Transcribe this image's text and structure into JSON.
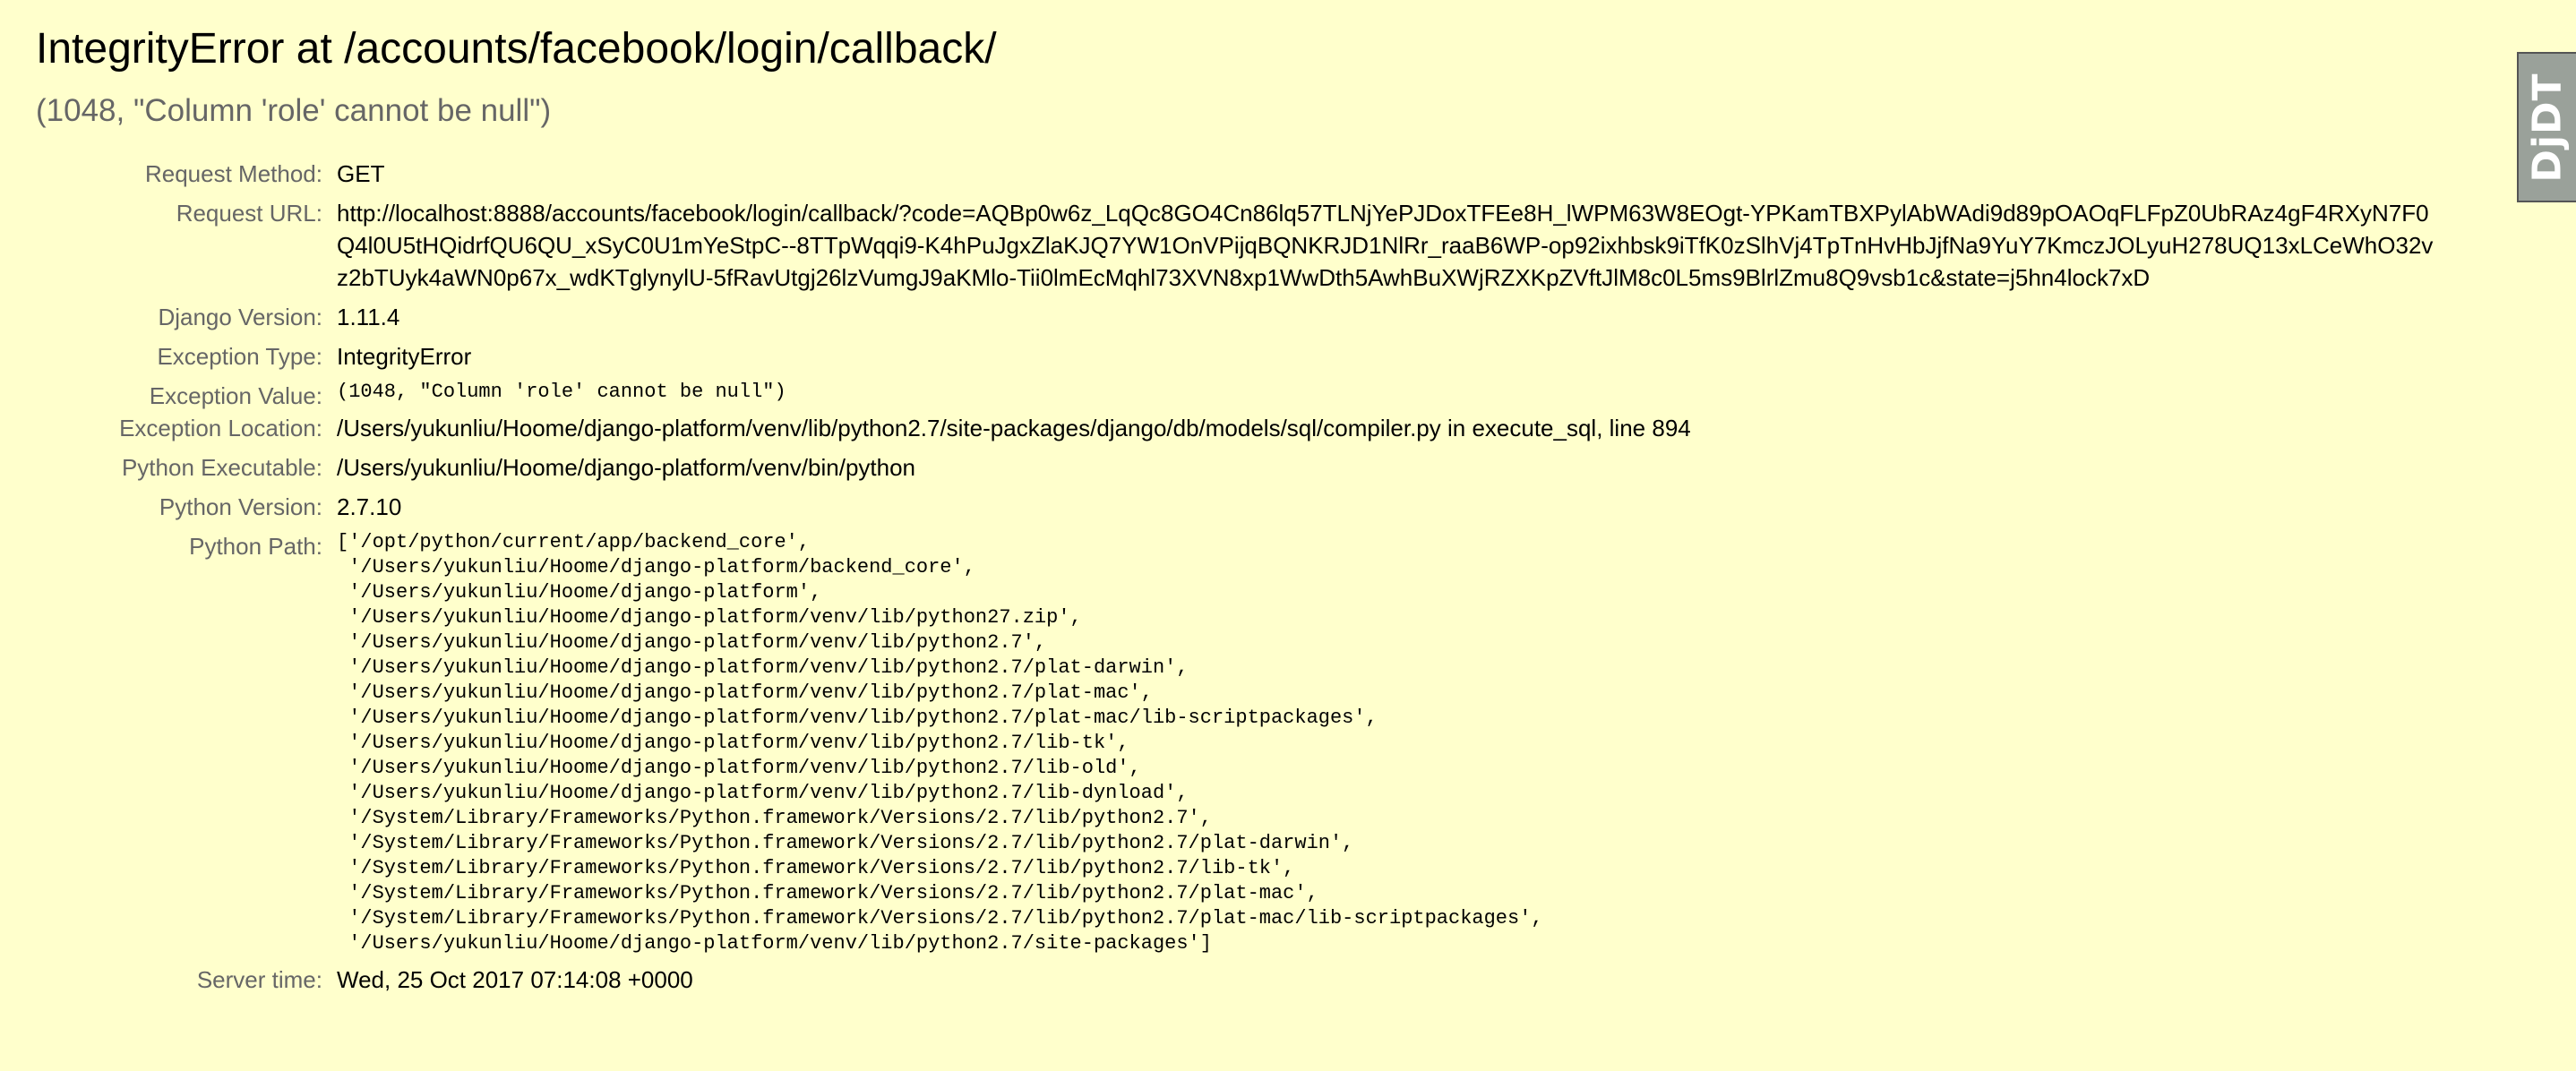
{
  "title": "IntegrityError at /accounts/facebook/login/callback/",
  "exception_summary": "(1048, \"Column 'role' cannot be null\")",
  "meta": {
    "request_method_label": "Request Method:",
    "request_method": "GET",
    "request_url_label": "Request URL:",
    "request_url": "http://localhost:8888/accounts/facebook/login/callback/?code=AQBp0w6z_LqQc8GO4Cn86lq57TLNjYePJDoxTFEe8H_lWPM63W8EOgt-YPKamTBXPylAbWAdi9d89pOAOqFLFpZ0UbRAz4gF4RXyN7F0Q4l0U5tHQidrfQU6QU_xSyC0U1mYeStpC--8TTpWqqi9-K4hPuJgxZlaKJQ7YW1OnVPijqBQNKRJD1NlRr_raaB6WP-op92ixhbsk9iTfK0zSlhVj4TpTnHvHbJjfNa9YuY7KmczJOLyuH278UQ13xLCeWhO32vz2bTUyk4aWN0p67x_wdKTglynylU-5fRavUtgj26lzVumgJ9aKMlo-Tii0lmEcMqhl73XVN8xp1WwDth5AwhBuXWjRZXKpZVftJlM8c0L5ms9BlrlZmu8Q9vsb1c&state=j5hn4lock7xD",
    "django_version_label": "Django Version:",
    "django_version": "1.11.4",
    "exception_type_label": "Exception Type:",
    "exception_type": "IntegrityError",
    "exception_value_label": "Exception Value:",
    "exception_value": "(1048, \"Column 'role' cannot be null\")",
    "exception_location_label": "Exception Location:",
    "exception_location": "/Users/yukunliu/Hoome/django-platform/venv/lib/python2.7/site-packages/django/db/models/sql/compiler.py in execute_sql, line 894",
    "python_executable_label": "Python Executable:",
    "python_executable": "/Users/yukunliu/Hoome/django-platform/venv/bin/python",
    "python_version_label": "Python Version:",
    "python_version": "2.7.10",
    "python_path_label": "Python Path:",
    "python_path": "['/opt/python/current/app/backend_core',\n '/Users/yukunliu/Hoome/django-platform/backend_core',\n '/Users/yukunliu/Hoome/django-platform',\n '/Users/yukunliu/Hoome/django-platform/venv/lib/python27.zip',\n '/Users/yukunliu/Hoome/django-platform/venv/lib/python2.7',\n '/Users/yukunliu/Hoome/django-platform/venv/lib/python2.7/plat-darwin',\n '/Users/yukunliu/Hoome/django-platform/venv/lib/python2.7/plat-mac',\n '/Users/yukunliu/Hoome/django-platform/venv/lib/python2.7/plat-mac/lib-scriptpackages',\n '/Users/yukunliu/Hoome/django-platform/venv/lib/python2.7/lib-tk',\n '/Users/yukunliu/Hoome/django-platform/venv/lib/python2.7/lib-old',\n '/Users/yukunliu/Hoome/django-platform/venv/lib/python2.7/lib-dynload',\n '/System/Library/Frameworks/Python.framework/Versions/2.7/lib/python2.7',\n '/System/Library/Frameworks/Python.framework/Versions/2.7/lib/python2.7/plat-darwin',\n '/System/Library/Frameworks/Python.framework/Versions/2.7/lib/python2.7/lib-tk',\n '/System/Library/Frameworks/Python.framework/Versions/2.7/lib/python2.7/plat-mac',\n '/System/Library/Frameworks/Python.framework/Versions/2.7/lib/python2.7/plat-mac/lib-scriptpackages',\n '/Users/yukunliu/Hoome/django-platform/venv/lib/python2.7/site-packages']",
    "server_time_label": "Server time:",
    "server_time": "Wed, 25 Oct 2017 07:14:08 +0000"
  },
  "debug_toolbar": {
    "handle_text": "DjDT",
    "handle_icon": "djdt-logo-icon"
  },
  "colors": {
    "background": "#ffffcc",
    "label": "#666666",
    "handle_bg": "#9aa19a"
  }
}
